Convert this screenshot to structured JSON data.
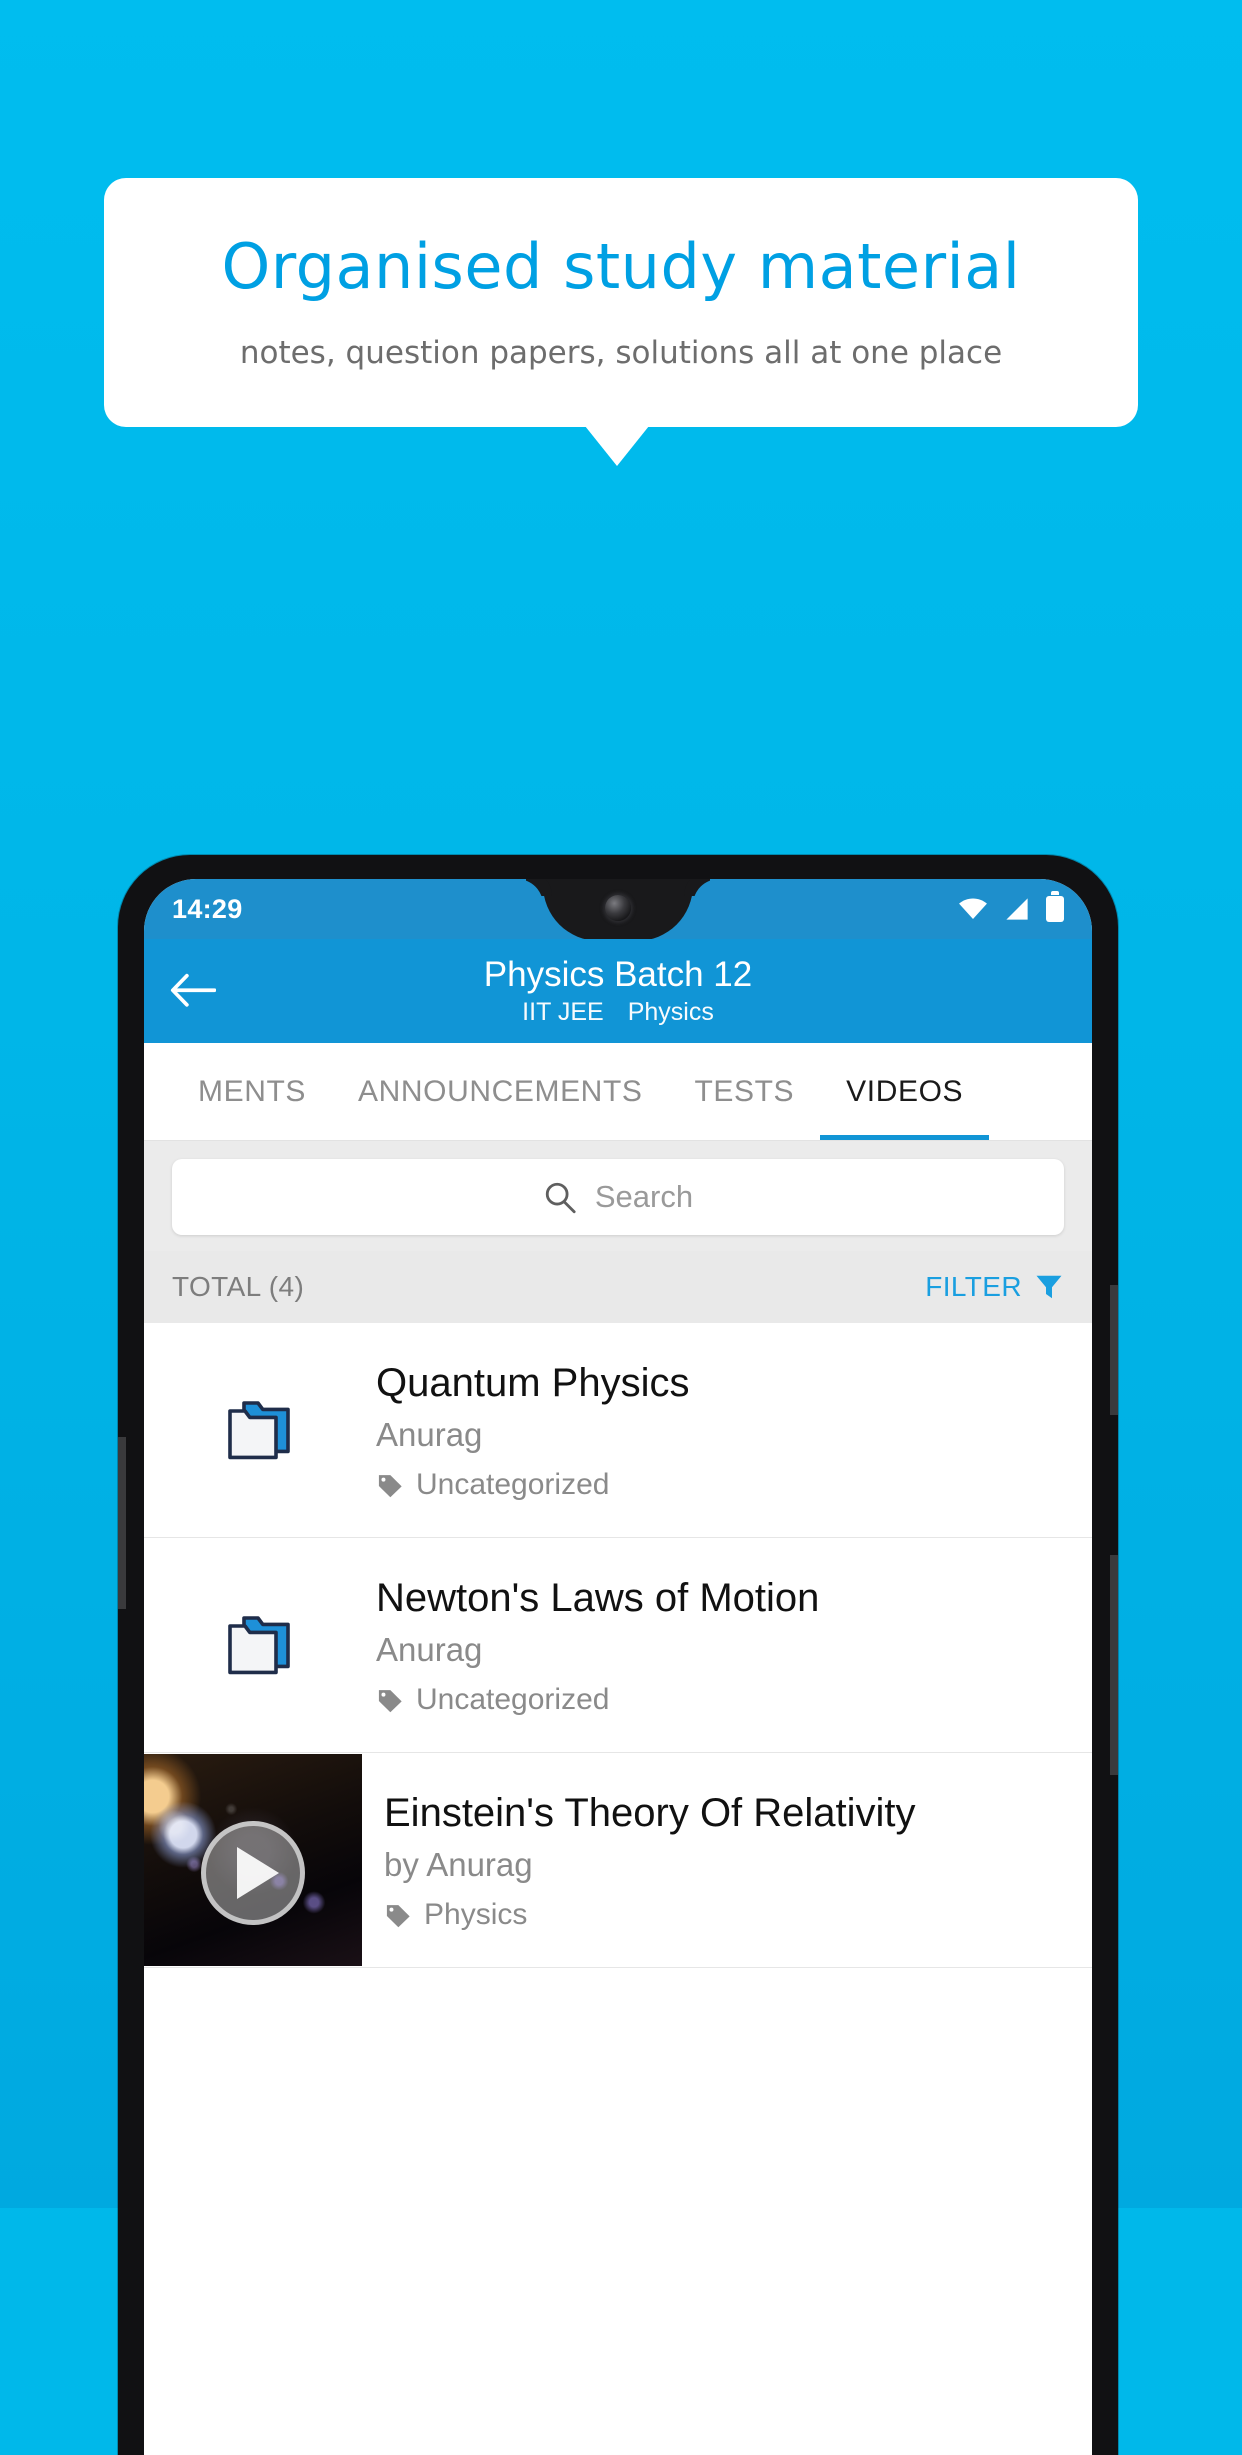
{
  "promo": {
    "title": "Organised study material",
    "subtitle": "notes, question papers, solutions all at one place",
    "title_color": "#00a0e3",
    "background_color": "#00b8ea"
  },
  "phone": {
    "status_bar": {
      "time": "14:29",
      "icons": [
        "wifi-icon",
        "signal-icon",
        "battery-icon"
      ],
      "background_color": "#1e8fcc"
    },
    "app_bar": {
      "back_label": "back-arrow-icon",
      "title": "Physics Batch 12",
      "subtitle_exam": "IIT JEE",
      "subtitle_subject": "Physics",
      "background_color": "#1195d6"
    },
    "tabs": [
      {
        "label": "MENTS",
        "active": false
      },
      {
        "label": "ANNOUNCEMENTS",
        "active": false
      },
      {
        "label": "TESTS",
        "active": false
      },
      {
        "label": "VIDEOS",
        "active": true
      }
    ],
    "search": {
      "placeholder": "Search",
      "icon": "search-icon"
    },
    "list_header": {
      "total_label": "TOTAL (4)",
      "filter_label": "FILTER",
      "filter_icon": "filter-funnel-icon",
      "filter_color": "#1a9fe0"
    },
    "items": [
      {
        "type": "folder",
        "icon": "folder-icon",
        "title": "Quantum Physics",
        "author": "Anurag",
        "tag": "Uncategorized",
        "tag_icon": "tag-icon"
      },
      {
        "type": "folder",
        "icon": "folder-icon",
        "title": "Newton's Laws of Motion",
        "author": "Anurag",
        "tag": "Uncategorized",
        "tag_icon": "tag-icon"
      },
      {
        "type": "video",
        "icon": "video-thumbnail",
        "title": "Einstein's Theory Of Relativity",
        "author": "by Anurag",
        "tag": "Physics",
        "tag_icon": "tag-icon",
        "play_icon": "play-icon"
      }
    ]
  }
}
